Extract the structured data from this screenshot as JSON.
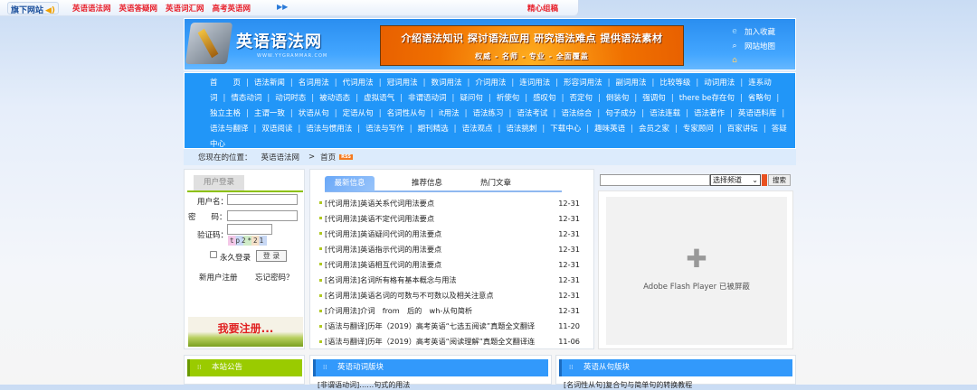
{
  "topbar": {
    "brand": "旗下网站",
    "links": [
      "英语语法网",
      "英语答疑网",
      "英语词汇网",
      "高考英语网"
    ],
    "featured": "精心组稿"
  },
  "header": {
    "logo_text": "英语语法网",
    "logo_url": "WWW.YYGRAMMAR.COM",
    "banner_line1": "介绍语法知识  探讨语法应用  研究语法难点  提供语法素材",
    "banner_line2": "权威 - 名师 - 专业 - 全面覆盖",
    "links": [
      "加入收藏",
      "网站地图"
    ]
  },
  "nav": [
    "首　　页",
    "语法新闻",
    "名词用法",
    "代词用法",
    "冠词用法",
    "数词用法",
    "介词用法",
    "连词用法",
    "形容词用法",
    "副词用法",
    "比较等级",
    "动词用法",
    "连系动词",
    "情态动词",
    "动词时态",
    "被动语态",
    "虚拟语气",
    "非谓语动词",
    "疑问句",
    "祈使句",
    "感叹句",
    "否定句",
    "倒装句",
    "强调句",
    "there be存在句",
    "省略句",
    "独立主格",
    "主谓一致",
    "状语从句",
    "定语从句",
    "名词性从句",
    "it用法",
    "语法练习",
    "语法考试",
    "语法综合",
    "句子成分",
    "语法连载",
    "语法著作",
    "英语语料库",
    "语法与翻译",
    "双语阅读",
    "语法与惯用法",
    "语法与写作",
    "期刊精选",
    "语法观点",
    "语法挑刺",
    "下载中心",
    "趣味英语",
    "会员之家",
    "专家顾问",
    "百家讲坛",
    "答疑中心"
  ],
  "breadcrumb": {
    "label": "您现在的位置：",
    "site": "英语语法网",
    "sep": ">",
    "current": "首页",
    "rss": "RSS"
  },
  "login": {
    "tab": "用户登录",
    "username_label": "用户名：",
    "password_label": "密　　码：",
    "captcha_label": "验证码：",
    "captcha": "tp2*21",
    "remember": "永久登录",
    "submit": "登 录",
    "register": "新用户注册",
    "forgot": "忘记密码？",
    "banner": "我要注册..."
  },
  "news": {
    "tabs": [
      "最新信息",
      "推荐信息",
      "热门文章"
    ],
    "items": [
      {
        "title": "[代词用法]英语关系代词用法要点",
        "date": "12-31"
      },
      {
        "title": "[代词用法]英语不定代词用法要点",
        "date": "12-31"
      },
      {
        "title": "[代词用法]英语疑问代词的用法要点",
        "date": "12-31"
      },
      {
        "title": "[代词用法]英语指示代词的用法要点",
        "date": "12-31"
      },
      {
        "title": "[代词用法]英语相互代词的用法要点",
        "date": "12-31"
      },
      {
        "title": "[名词用法]名词所有格有基本概念与用法",
        "date": "12-31"
      },
      {
        "title": "[名词用法]英语名词的可数与不可数以及相关注意点",
        "date": "12-31"
      },
      {
        "title": "[介词用法]介词　from　后的　wh-从句简析",
        "date": "12-31"
      },
      {
        "title": "[语法与翻译]历年（2019）高考英语“七选五阅读”真题全文翻译",
        "date": "11-20"
      },
      {
        "title": "[语法与翻译]历年（2019）高考英语“阅读理解”真题全文翻译连",
        "date": "11-06"
      }
    ]
  },
  "search": {
    "select": "选择频道",
    "button": "搜索",
    "flash": "Adobe Flash Player 已被屏蔽"
  },
  "bottom": [
    {
      "title": "本站公告",
      "first": ""
    },
    {
      "title": "英语动词版块",
      "first": "[非谓语动词]……句式的用法"
    },
    {
      "title": "英语从句版块",
      "first": "[名词性从句]复合句与简单句的转换教程"
    }
  ]
}
